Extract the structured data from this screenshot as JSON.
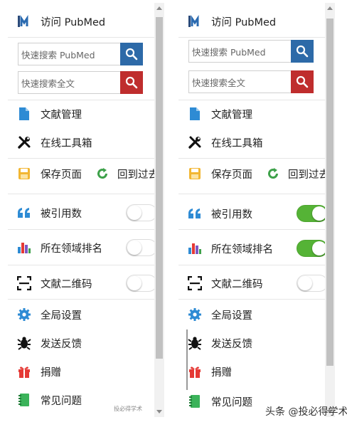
{
  "panels": [
    {
      "id": "left",
      "header": "访问 PubMed",
      "search_pubmed_placeholder": "快速搜索 PubMed",
      "search_fulltext_placeholder": "快速搜索全文",
      "doc_manage": "文献管理",
      "online_tools": "在线工具箱",
      "save_page": "保存页面",
      "back": "回到过去",
      "cited_count": "被引用数",
      "cited_on": false,
      "field_rank": "所在领域排名",
      "rank_on": false,
      "qr_code": "文献二维码",
      "qr_on": false,
      "global_settings": "全局设置",
      "feedback": "发送反馈",
      "donate": "捐赠",
      "faq": "常见问题"
    },
    {
      "id": "right",
      "header": "访问 PubMed",
      "search_pubmed_placeholder": "快速搜索 PubMed",
      "search_fulltext_placeholder": "快速搜索全文",
      "doc_manage": "文献管理",
      "online_tools": "在线工具箱",
      "save_page": "保存页面",
      "back": "回到过去",
      "cited_count": "被引用数",
      "cited_on": true,
      "field_rank": "所在领域排名",
      "rank_on": true,
      "qr_code": "文献二维码",
      "qr_on": false,
      "global_settings": "全局设置",
      "feedback": "发送反馈",
      "donate": "捐赠",
      "faq": "常见问题"
    }
  ],
  "watermarks": {
    "left": "投必得学术",
    "right": "头条 @投必得学术"
  },
  "colors": {
    "search_button": "#2d6aa8",
    "fulltext_button": "#bf2d2d",
    "toggle_on": "#55b336",
    "doc_icon": "#2e8bd4",
    "save_icon": "#f2b632",
    "refresh_icon": "#3ea14a",
    "quote_icon": "#2e8bd4",
    "gear_icon": "#2e8bd4",
    "gift_icon": "#e53935",
    "faq_icon": "#3bb35a"
  }
}
